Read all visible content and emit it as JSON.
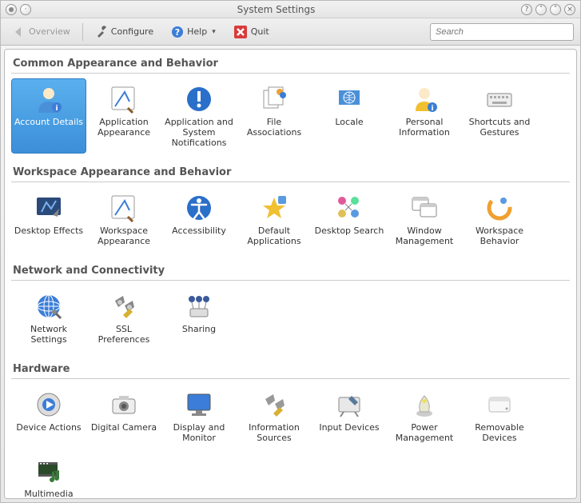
{
  "window": {
    "title": "System Settings"
  },
  "toolbar": {
    "overview": "Overview",
    "configure": "Configure",
    "help": "Help",
    "quit": "Quit"
  },
  "search": {
    "placeholder": "Search"
  },
  "sections": {
    "common": {
      "title": "Common Appearance and Behavior",
      "account_details": "Account Details",
      "application_appearance": "Application Appearance",
      "app_sys_notifications": "Application and System Notifications",
      "file_associations": "File Associations",
      "locale": "Locale",
      "personal_information": "Personal Information",
      "shortcuts_gestures": "Shortcuts and Gestures"
    },
    "workspace": {
      "title": "Workspace Appearance and Behavior",
      "desktop_effects": "Desktop Effects",
      "workspace_appearance": "Workspace Appearance",
      "accessibility": "Accessibility",
      "default_applications": "Default Applications",
      "desktop_search": "Desktop Search",
      "window_management": "Window Management",
      "workspace_behavior": "Workspace Behavior"
    },
    "network": {
      "title": "Network and Connectivity",
      "network_settings": "Network Settings",
      "ssl_preferences": "SSL Preferences",
      "sharing": "Sharing"
    },
    "hardware": {
      "title": "Hardware",
      "device_actions": "Device Actions",
      "digital_camera": "Digital Camera",
      "display_monitor": "Display and Monitor",
      "information_sources": "Information Sources",
      "input_devices": "Input Devices",
      "power_management": "Power Management",
      "removable_devices": "Removable Devices",
      "multimedia": "Multimedia"
    }
  }
}
